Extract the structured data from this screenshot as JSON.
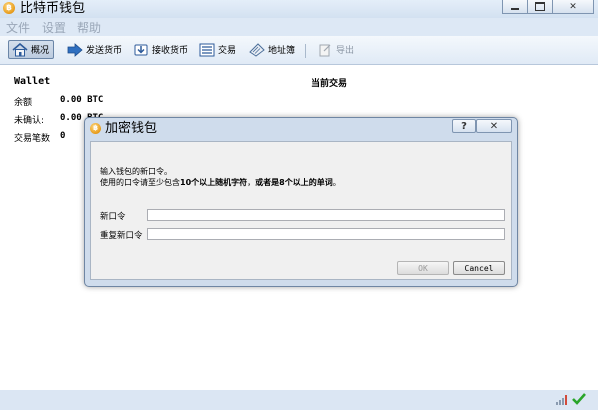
{
  "window": {
    "title": "比特币钱包",
    "app_icon": "bitcoin-icon"
  },
  "menu": [
    "文件",
    "设置",
    "帮助"
  ],
  "toolbar": {
    "buttons": [
      {
        "label": "概况",
        "icon": "home-icon"
      },
      {
        "label": "发送货币",
        "icon": "send-arrow-icon"
      },
      {
        "label": "接收货币",
        "icon": "receive-icon"
      },
      {
        "label": "交易",
        "icon": "list-icon"
      },
      {
        "label": "地址簿",
        "icon": "address-book-icon"
      },
      {
        "label": "导出",
        "icon": "export-icon"
      }
    ]
  },
  "overview": {
    "wallet_label": "Wallet",
    "balance_label": "余额",
    "balance_value": "0.00 BTC",
    "unconfirmed_label": "未确认:",
    "unconfirmed_value": "0.00 BTC",
    "tx_count_label": "交易笔数",
    "tx_count_value": "0",
    "recent_tx_label": "当前交易"
  },
  "dialog": {
    "title": "加密钱包",
    "line1": "输入钱包的新口令。",
    "line2_prefix": "使用的口令请至少包含",
    "line2_bold1": "10个以上随机字符",
    "line2_mid": "，",
    "line2_bold2": "或者是8个以上的单词",
    "line2_end": "。",
    "new_pass_label": "新口令",
    "repeat_pass_label": "重复新口令",
    "ok_label": "OK",
    "cancel_label": "Cancel"
  },
  "colors": {
    "accent": "#dbe6f3",
    "check": "#2aa52a"
  }
}
